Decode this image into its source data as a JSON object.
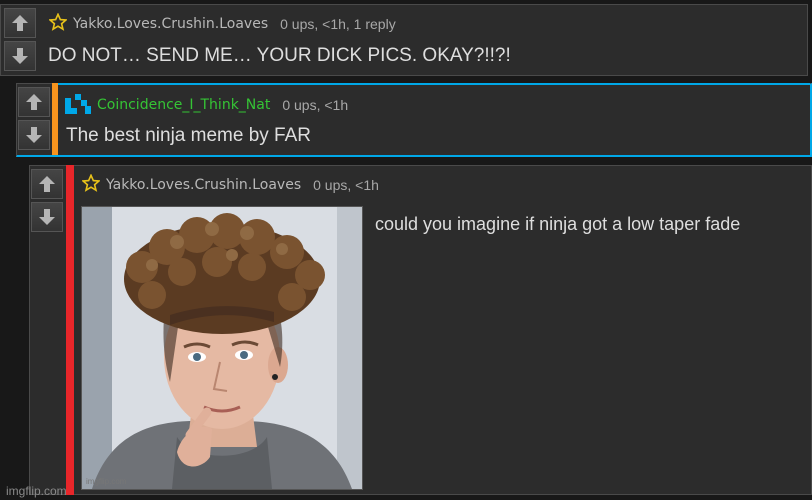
{
  "colors": {
    "background": "#181818",
    "comment_bg": "#2c2c2c",
    "accent_orange": "#f7941e",
    "accent_blue": "#00a8e8",
    "accent_red": "#e8262a",
    "username_green": "#35c435",
    "star_gold": "#e8c21a"
  },
  "comments": [
    {
      "username": "Yakko.Loves.Crushin.Loaves",
      "meta": "0 ups, <1h, 1 reply",
      "text": "DO NOT… SEND ME… YOUR DICK PICS. OKAY?!!?!",
      "user_icon": "star-icon"
    },
    {
      "username": "Coincidence_I_Think_Nat",
      "meta": "0 ups, <1h",
      "text": "The best ninja meme by FAR",
      "user_icon": "pixel-badge-icon"
    },
    {
      "username": "Yakko.Loves.Crushin.Loaves",
      "meta": "0 ups, <1h",
      "text": "could you imagine if ninja got a low taper fade",
      "user_icon": "star-icon",
      "image_watermark": "imgflip.com"
    }
  ],
  "footer": {
    "watermark": "imgflip.com"
  }
}
